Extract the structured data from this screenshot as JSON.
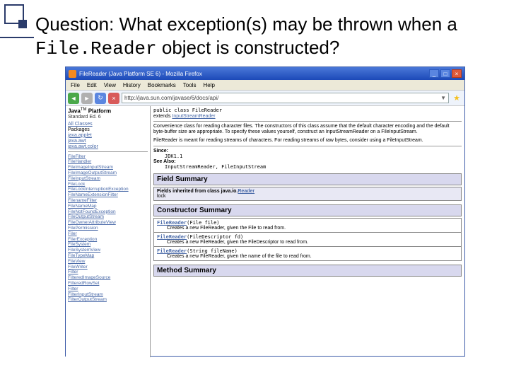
{
  "slide": {
    "question_pre": "Question: What exception(s) may be thrown when a ",
    "question_code": "File.Reader",
    "question_post": " object is constructed?"
  },
  "titlebar": {
    "text": "FileReader (Java Platform SE 6) - Mozilla Firefox"
  },
  "winbtns": {
    "min": "_",
    "max": "□",
    "close": "×"
  },
  "menu": {
    "file": "File",
    "edit": "Edit",
    "view": "View",
    "history": "History",
    "bookmarks": "Bookmarks",
    "tools": "Tools",
    "help": "Help"
  },
  "nav": {
    "back": "◄",
    "fwd": "►",
    "reload": "↻",
    "stop": "×",
    "star": "★",
    "dropdown": "▼"
  },
  "url": "http://java.sun.com/javase/6/docs/api/",
  "sidebar": {
    "title_pre": "Java",
    "title_tm": "TM",
    "title_post": " Platform",
    "subtitle": "Standard Ed. 6",
    "all_classes": "All Classes",
    "pkg_head": "Packages",
    "pkgs": [
      "java.applet",
      "java.awt",
      "java.awt.color"
    ],
    "classlist": [
      "FileFilter",
      "FileHandler",
      "FileImageInputStream",
      "FileImageOutputStream",
      "FileInputStream",
      "FileLock",
      "FileLockInterruptionException",
      "FileNameExtensionFilter",
      "FilenameFilter",
      "FileNameMap",
      "FileNotFoundException",
      "FileOutputStream",
      "FileOwnerAttributeView",
      "FilePermission",
      "Filer",
      "FilerException",
      "FileSystem",
      "FileSystemView",
      "FileTypeMap",
      "FileView",
      "FileWriter",
      "Filter",
      "FilteredImageSource",
      "FilteredRowSet",
      "Filter",
      "FilterInputStream",
      "FilterOutputStream"
    ]
  },
  "main": {
    "decl": "public class FileReader",
    "ext_pre": "extends ",
    "ext_link": "InputStreamReader",
    "desc1": "Convenience class for reading character files. The constructors of this class assume that the default character encoding and the default byte-buffer size are appropriate. To specify these values yourself, construct an InputStreamReader on a FileInputStream.",
    "desc2": "FileReader is meant for reading streams of characters. For reading streams of raw bytes, consider using a FileInputStream.",
    "since_label": "Since:",
    "since_val": "JDK1.1",
    "see_label": "See Also:",
    "see_val": "InputStreamReader, FileInputStream",
    "field_head": "Field Summary",
    "inherit_pre": "Fields inherited from class java.io.",
    "inherit_link": "Reader",
    "inherit_fields": "lock",
    "ctor_head": "Constructor Summary",
    "ctor1_sig_pre": "FileReader",
    "ctor1_sig_arg": "(File file)",
    "ctor1_desc": "Creates a new FileReader, given the File to read from.",
    "ctor2_sig_pre": "FileReader",
    "ctor2_sig_arg": "(FileDescriptor fd)",
    "ctor2_desc": "Creates a new FileReader, given the FileDescriptor to read from.",
    "ctor3_sig_pre": "FileReader",
    "ctor3_sig_arg": "(String fileName)",
    "ctor3_desc": "Creates a new FileReader, given the name of the file to read from.",
    "method_head": "Method Summary"
  }
}
